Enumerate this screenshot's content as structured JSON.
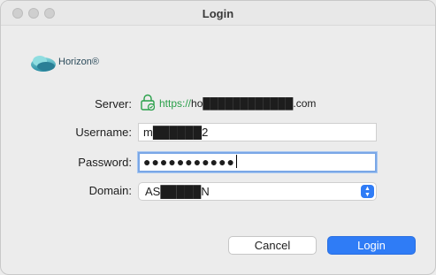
{
  "window": {
    "title": "Login"
  },
  "logo": {
    "text": "Horizon®"
  },
  "form": {
    "server_label": "Server:",
    "server_url_scheme": "https://",
    "server_url_rest": "ho████████████.com",
    "username_label": "Username:",
    "username_value": "m██████2",
    "password_label": "Password:",
    "password_value": "●●●●●●●●●●●",
    "domain_label": "Domain:",
    "domain_value": "AS█████N"
  },
  "buttons": {
    "cancel": "Cancel",
    "login": "Login"
  },
  "colors": {
    "accent": "#2f7cf6",
    "secure": "#2aa04a"
  },
  "icons": {
    "lock": "lock-icon",
    "select": "select-arrows-icon"
  }
}
